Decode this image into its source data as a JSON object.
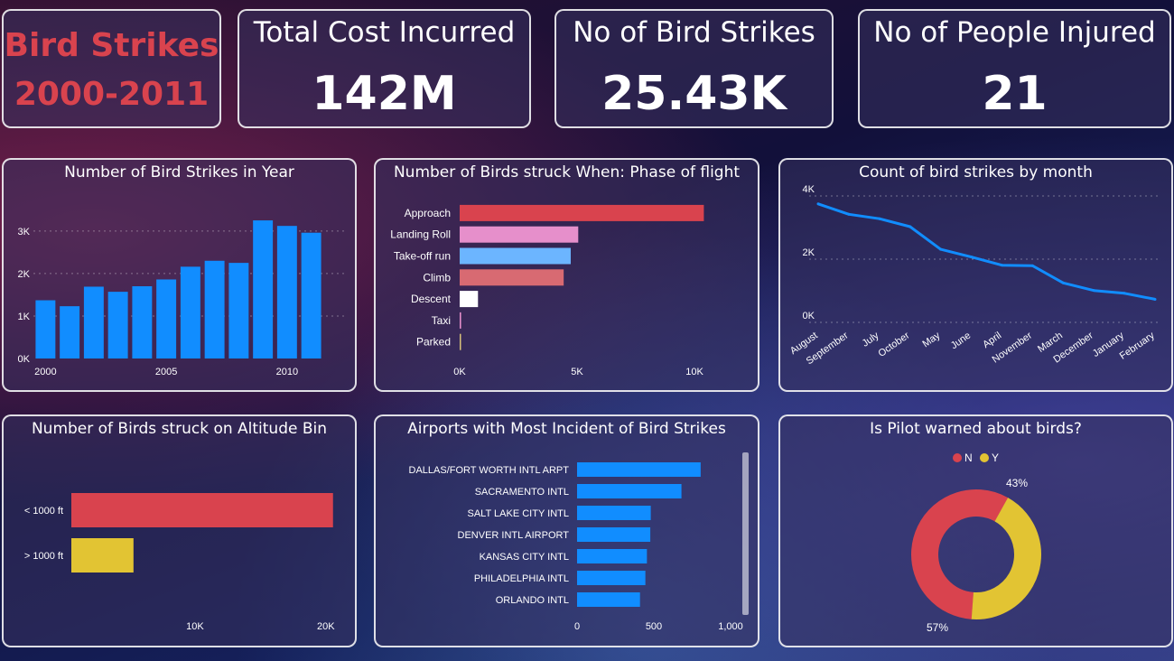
{
  "colors": {
    "blue": "#118DFF",
    "red": "#D9434E",
    "yellow": "#E2C433",
    "pink": "#E68FCB",
    "lightblue": "#6CB5FF",
    "salmon": "#D86A72",
    "white": "#FFFFFF"
  },
  "brand": {
    "line1": "Bird Strikes",
    "line2": "2000-2011"
  },
  "kpis": [
    {
      "title": "Total Cost Incurred",
      "value": "142M"
    },
    {
      "title": "No of Bird Strikes",
      "value": "25.43K"
    },
    {
      "title": "No of People Injured",
      "value": "21"
    }
  ],
  "chart_data": [
    {
      "type": "bar",
      "title": "Number of Bird Strikes in Year",
      "categories": [
        2000,
        2001,
        2002,
        2003,
        2004,
        2005,
        2006,
        2007,
        2008,
        2009,
        2010,
        2011
      ],
      "values": [
        1370,
        1230,
        1690,
        1570,
        1700,
        1860,
        2160,
        2300,
        2250,
        3250,
        3120,
        2960
      ],
      "ylim": [
        0,
        3400
      ],
      "yticks": [
        {
          "v": 0,
          "label": "0K"
        },
        {
          "v": 1000,
          "label": "1K"
        },
        {
          "v": 2000,
          "label": "2K"
        },
        {
          "v": 3000,
          "label": "3K"
        }
      ],
      "xticks": [
        {
          "v": 2000,
          "label": "2000"
        },
        {
          "v": 2005,
          "label": "2005"
        },
        {
          "v": 2010,
          "label": "2010"
        }
      ],
      "grid": true
    },
    {
      "type": "bar",
      "orientation": "horizontal",
      "title": "Number of Birds struck When: Phase of flight",
      "categories": [
        "Approach",
        "Landing Roll",
        "Take-off run",
        "Climb",
        "Descent",
        "Taxi",
        "Parked"
      ],
      "values": [
        10400,
        5050,
        4730,
        4430,
        780,
        60,
        40
      ],
      "colors": [
        "#D9434E",
        "#E68FCB",
        "#6CB5FF",
        "#D86A72",
        "#FFFFFF",
        "#E68FCB",
        "#D9C27A"
      ],
      "xlim": [
        0,
        12000
      ],
      "xticks": [
        {
          "v": 0,
          "label": "0K"
        },
        {
          "v": 5000,
          "label": "5K"
        },
        {
          "v": 10000,
          "label": "10K"
        }
      ]
    },
    {
      "type": "line",
      "title": "Count of bird strikes by month",
      "categories": [
        "August",
        "September",
        "July",
        "October",
        "May",
        "June",
        "April",
        "November",
        "March",
        "December",
        "January",
        "February"
      ],
      "values": [
        3750,
        3420,
        3280,
        3030,
        2310,
        2070,
        1810,
        1790,
        1250,
        1010,
        920,
        730
      ],
      "ylim": [
        0,
        4000
      ],
      "yticks": [
        {
          "v": 0,
          "label": "0K"
        },
        {
          "v": 2000,
          "label": "2K"
        },
        {
          "v": 4000,
          "label": "4K"
        }
      ],
      "grid": true
    },
    {
      "type": "bar",
      "orientation": "horizontal",
      "title": "Number of Birds struck on Altitude Bin",
      "categories": [
        "< 1000 ft",
        "> 1000 ft"
      ],
      "values": [
        20000,
        4750
      ],
      "colors": [
        "#D9434E",
        "#E2C433"
      ],
      "xlim": [
        0,
        20500
      ],
      "xticks": [
        {
          "v": 10000,
          "label": "10K"
        },
        {
          "v": 20000,
          "label": "20K"
        }
      ]
    },
    {
      "type": "bar",
      "orientation": "horizontal",
      "title": "Airports with Most Incident of Bird Strikes",
      "categories": [
        "DALLAS/FORT WORTH INTL ARPT",
        "SACRAMENTO INTL",
        "SALT LAKE CITY INTL",
        "DENVER INTL AIRPORT",
        "KANSAS CITY INTL",
        "PHILADELPHIA INTL",
        "ORLANDO INTL"
      ],
      "values": [
        805,
        680,
        480,
        477,
        455,
        445,
        410
      ],
      "xlim": [
        0,
        1000
      ],
      "xticks": [
        {
          "v": 0,
          "label": "0"
        },
        {
          "v": 500,
          "label": "500"
        },
        {
          "v": 1000,
          "label": "1,000"
        }
      ]
    },
    {
      "type": "pie",
      "donut": true,
      "title": "Is Pilot warned about birds?",
      "legend": [
        "N",
        "Y"
      ],
      "legend_position": "top-center",
      "slices": [
        {
          "label": "N",
          "value": 57,
          "text": "57%",
          "color": "#D9434E"
        },
        {
          "label": "Y",
          "value": 43,
          "text": "43%",
          "color": "#E2C433"
        }
      ]
    }
  ]
}
